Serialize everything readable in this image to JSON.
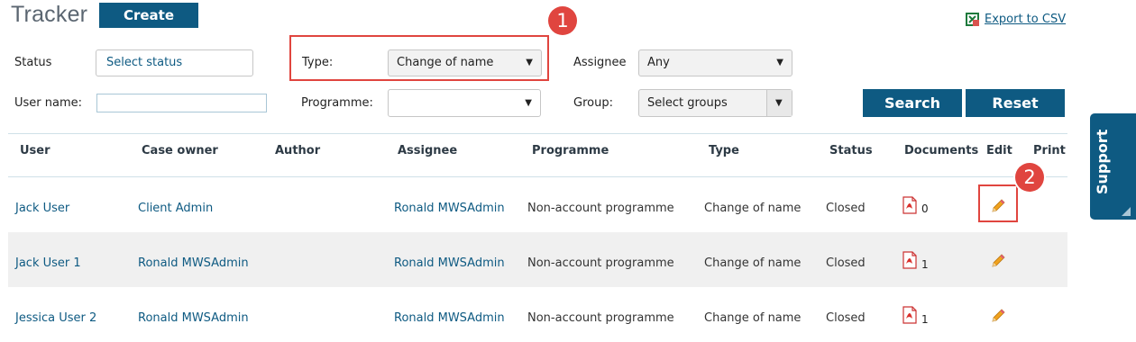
{
  "page": {
    "title": "Tracker",
    "create_label": "Create",
    "export_label": "Export to CSV"
  },
  "filters": {
    "status_label": "Status",
    "status_value": "Select status",
    "type_label": "Type:",
    "type_value": "Change of name",
    "assignee_label": "Assignee",
    "assignee_value": "Any",
    "username_label": "User name:",
    "username_value": "",
    "programme_label": "Programme:",
    "programme_value": "",
    "group_label": "Group:",
    "group_value": "Select groups",
    "search_label": "Search",
    "reset_label": "Reset"
  },
  "annotations": {
    "badge1": "1",
    "badge2": "2"
  },
  "table": {
    "headers": [
      "User",
      "Case owner",
      "Author",
      "Assignee",
      "Programme",
      "Type",
      "Status",
      "Documents",
      "Edit",
      "Print"
    ],
    "rows": [
      {
        "user": "Jack User",
        "case_owner": "Client Admin",
        "author": "",
        "assignee": "Ronald MWSAdmin",
        "programme": "Non-account programme",
        "type": "Change of name",
        "status": "Closed",
        "documents": "0"
      },
      {
        "user": "Jack User 1",
        "case_owner": "Ronald MWSAdmin",
        "author": "",
        "assignee": "Ronald MWSAdmin",
        "programme": "Non-account programme",
        "type": "Change of name",
        "status": "Closed",
        "documents": "1"
      },
      {
        "user": "Jessica User 2",
        "case_owner": "Ronald MWSAdmin",
        "author": "",
        "assignee": "Ronald MWSAdmin",
        "programme": "Non-account programme",
        "type": "Change of name",
        "status": "Closed",
        "documents": "1"
      }
    ]
  },
  "support_label": "Support",
  "colors": {
    "accent": "#0e5a82",
    "highlight": "#e0453f",
    "row_shade": "#f0f0f0"
  },
  "icons": {
    "export": "excel-icon",
    "documents": "pdf-icon",
    "edit": "pencil-icon"
  }
}
